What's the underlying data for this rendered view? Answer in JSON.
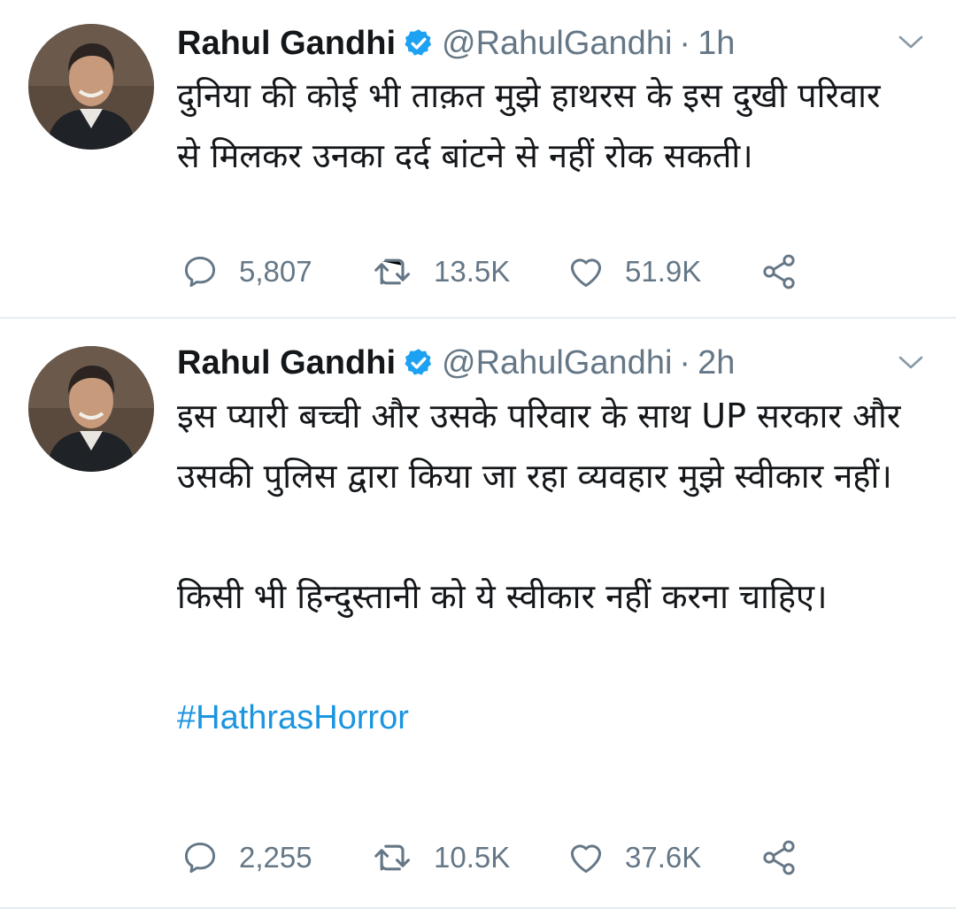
{
  "colors": {
    "text": "#14171a",
    "secondary": "#657786",
    "link": "#1b95e0",
    "verified": "#1da1f2",
    "divider": "#e6ecf0"
  },
  "tweets": [
    {
      "author_name": "Rahul Gandhi",
      "handle": "@RahulGandhi",
      "separator": "·",
      "time": "1h",
      "verified_icon": "verified-badge-icon",
      "paragraphs": [
        "दुनिया की कोई भी ताक़त मुझे हाथरस के इस दुखी परिवार से मिलकर उनका दर्द बांटने से नहीं रोक सकती।"
      ],
      "hashtag": "",
      "replies": "5,807",
      "retweets": "13.5K",
      "likes": "51.9K"
    },
    {
      "author_name": "Rahul Gandhi",
      "handle": "@RahulGandhi",
      "separator": "·",
      "time": "2h",
      "verified_icon": "verified-badge-icon",
      "paragraphs": [
        "इस प्यारी बच्ची और उसके परिवार के साथ UP सरकार और उसकी पुलिस द्वारा किया जा रहा व्यवहार मुझे स्वीकार नहीं।",
        "किसी भी हिन्दुस्तानी को ये स्वीकार नहीं करना चाहिए।"
      ],
      "hashtag": "#HathrasHorror",
      "replies": "2,255",
      "retweets": "10.5K",
      "likes": "37.6K"
    }
  ]
}
